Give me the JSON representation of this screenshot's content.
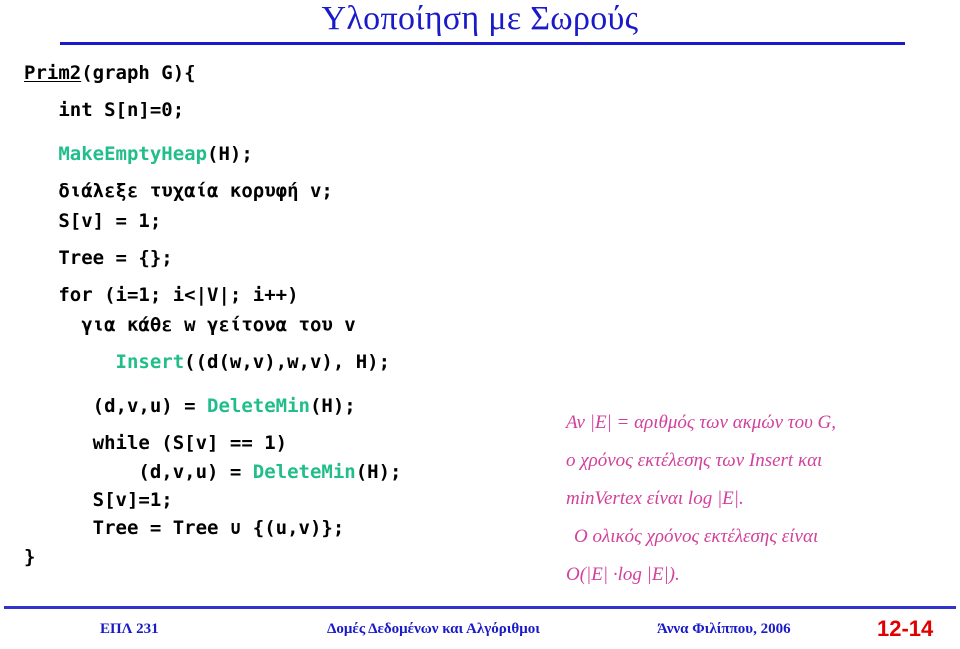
{
  "slide": {
    "title": "Υλοποίηση με Σωρούς",
    "title_color": "#1a1ac8",
    "rule_color": "#1a1ac8"
  },
  "code": {
    "text_color": "#000000",
    "function_color": "#21bd8a",
    "lines": [
      {
        "indent": 0,
        "segments": [
          {
            "t": "Prim2",
            "style": "underline"
          },
          {
            "t": "(graph G){",
            "style": "plain"
          }
        ],
        "spacing": "normal"
      },
      {
        "indent": 0,
        "segments": [
          {
            "t": "   int S[n]=0;",
            "style": "plain"
          }
        ],
        "spacing": "gap"
      },
      {
        "indent": 0,
        "segments": [
          {
            "t": "   ",
            "style": "plain"
          },
          {
            "t": "MakeEmptyHeap",
            "style": "fn-bold"
          },
          {
            "t": "(H);",
            "style": "plain"
          }
        ],
        "spacing": "gap"
      },
      {
        "indent": 0,
        "segments": [
          {
            "t": "   διάλεξε τυχαία κορυφή v;",
            "style": "plain"
          }
        ],
        "spacing": "normal"
      },
      {
        "indent": 0,
        "segments": [
          {
            "t": "   S[v] = 1;",
            "style": "plain"
          }
        ],
        "spacing": "normal"
      },
      {
        "indent": 0,
        "segments": [
          {
            "t": "   Tree = {};",
            "style": "plain"
          }
        ],
        "spacing": "gap"
      },
      {
        "indent": 0,
        "segments": [
          {
            "t": "   for (i=1; i<|V|; i++)",
            "style": "plain"
          }
        ],
        "spacing": "normal"
      },
      {
        "indent": 0,
        "segments": [
          {
            "t": "     για κάθε w γείτονα του v",
            "style": "plain"
          }
        ],
        "spacing": "normal"
      },
      {
        "indent": 0,
        "segments": [
          {
            "t": "        ",
            "style": "plain"
          },
          {
            "t": "Insert",
            "style": "fn"
          },
          {
            "t": "((d(w,v),w,v), H);",
            "style": "plain"
          }
        ],
        "spacing": "gap"
      },
      {
        "indent": 0,
        "segments": [
          {
            "t": "      (d,v,u) = ",
            "style": "plain"
          },
          {
            "t": "DeleteMin",
            "style": "fn"
          },
          {
            "t": "(H);",
            "style": "plain"
          }
        ],
        "spacing": "gap"
      },
      {
        "indent": 0,
        "segments": [
          {
            "t": "      while (S[v] == 1)",
            "style": "plain"
          }
        ],
        "spacing": "normal"
      },
      {
        "indent": 0,
        "segments": [
          {
            "t": "          (d,v,u) = ",
            "style": "plain"
          },
          {
            "t": "DeleteMin",
            "style": "fn"
          },
          {
            "t": "(H);",
            "style": "plain"
          }
        ],
        "spacing": "tight"
      },
      {
        "indent": 0,
        "segments": [
          {
            "t": "      S[v]=1;",
            "style": "plain"
          }
        ],
        "spacing": "tight"
      },
      {
        "indent": 0,
        "segments": [
          {
            "t": "      Tree = Tree ∪ {(u,v)};",
            "style": "plain"
          }
        ],
        "spacing": "tight"
      },
      {
        "indent": 0,
        "segments": [
          {
            "t": "}",
            "style": "plain"
          }
        ],
        "spacing": "normal"
      }
    ]
  },
  "note": {
    "color": "#d1409b",
    "lines": [
      {
        "text": "Αν |E| = αριθμός των ακμών του G,",
        "indent": false
      },
      {
        "text": "ο χρόνος εκτέλεσης των Insert και",
        "indent": false
      },
      {
        "text": "minVertex είναι log |E|.",
        "indent": false
      },
      {
        "text": "Ο ολικός χρόνος εκτέλεσης είναι",
        "indent": true
      },
      {
        "text": "O(|E| ·log |E|).",
        "indent": false
      }
    ]
  },
  "footer": {
    "course": "ΕΠΛ 231",
    "subject": "Δομές Δεδομένων και Αλγόριθμοι",
    "author": "Άννα Φιλίππου, 2006",
    "page": "12-14",
    "text_color": "#1a1ac8",
    "page_color": "#e00000",
    "rule_color": "#3333cc"
  }
}
